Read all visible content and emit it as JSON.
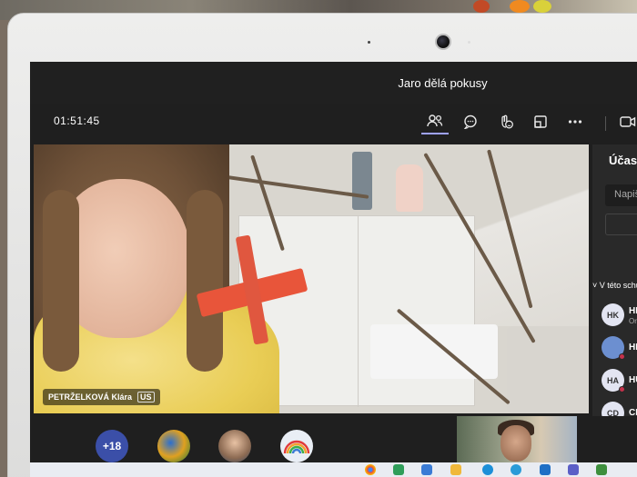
{
  "window": {
    "title": "Jaro dělá pokusy"
  },
  "toolbar": {
    "timer": "01:51:45",
    "icons": [
      "people-icon",
      "chat-icon",
      "reactions-icon",
      "rooms-icon",
      "more-icon",
      "camera-icon"
    ]
  },
  "main_video": {
    "participant_name": "PETRŽELKOVÁ Klára",
    "mic_indicator": "US"
  },
  "strip": {
    "overflow_count": "+18"
  },
  "panel": {
    "title": "Účastníci",
    "search_placeholder": "Napište jméno",
    "section_label": "V této schůzce",
    "participants": [
      {
        "initials": "HK",
        "name": "HK",
        "status": "Or"
      },
      {
        "initials": "",
        "name": "HR",
        "status": ""
      },
      {
        "initials": "HA",
        "name": "HU",
        "status": ""
      },
      {
        "initials": "CD",
        "name": "CH",
        "status": ""
      }
    ]
  }
}
